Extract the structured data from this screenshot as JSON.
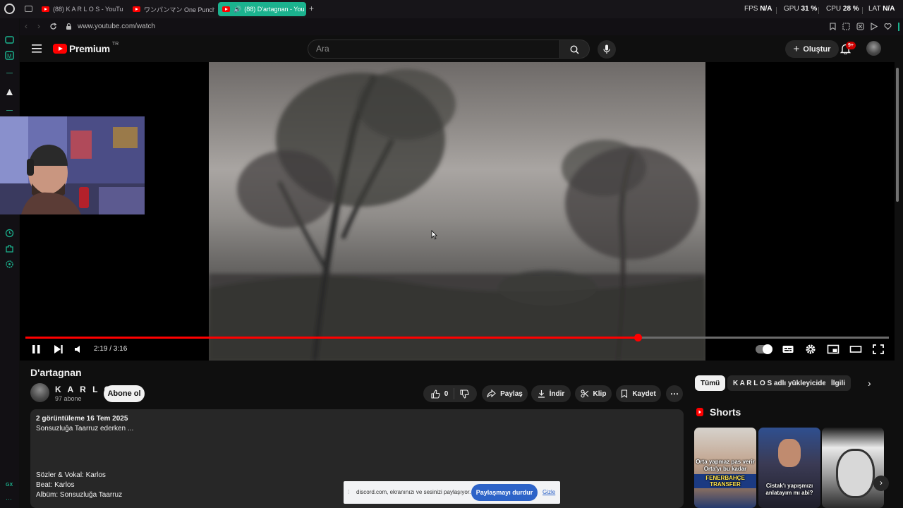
{
  "browser": {
    "tabs": [
      {
        "label": "(88) K A R L O S - YouTube",
        "active": false
      },
      {
        "label": "ワンパンマン One Punch Man",
        "active": false
      },
      {
        "label": "(88) D'artagnan - You",
        "active": true
      }
    ],
    "new_tab_label": "+",
    "stats": {
      "fps_label": "FPS",
      "fps_value": "N/A",
      "gpu_label": "GPU",
      "gpu_value": "31 %",
      "cpu_label": "CPU",
      "cpu_value": "28 %",
      "lat_label": "LAT",
      "lat_value": "N/A"
    },
    "url": "www.youtube.com/watch",
    "sidebar_footer": "GX"
  },
  "youtube": {
    "logo_text": "Premium",
    "logo_region": "TR",
    "search_placeholder": "Ara",
    "create_label": "Oluştur",
    "notifications_badge": "9+"
  },
  "player": {
    "time_display": "2:19 / 3:16",
    "progress_fraction": 0.709
  },
  "video": {
    "title": "D'artagnan",
    "channel_name": "K A R L O S",
    "subscribers": "97 abone",
    "subscribe_label": "Abone ol",
    "like_count": "0",
    "share_label": "Paylaş",
    "download_label": "İndir",
    "clip_label": "Klip",
    "save_label": "Kaydet",
    "more_label": "⋯",
    "views_date": "2 görüntüleme  16 Tem 2025",
    "description_lines": [
      "Sonsuzluğa Taarruz ederken ...",
      "Sözler & Vokal: Karlos",
      "Beat: Karlos",
      "Albüm: Sonsuzluğa Taarruz"
    ]
  },
  "sidebar_right": {
    "chips": [
      "Tümü",
      "K A R L O S adlı yükleyiciden",
      "İlgili"
    ],
    "shorts_title": "Shorts",
    "shorts": [
      {
        "caption_top": "Orta yapmaz pas verir",
        "caption_mid": "Orta'yı bu kadar",
        "caption_bottom": "FENERBAHÇE TRANSFER"
      },
      {
        "caption_top": "Cistak'ı yapışmızı",
        "caption_bottom": "anlatayım mı abi?"
      },
      {
        "caption_top": ""
      }
    ]
  },
  "discord_share": {
    "message": "discord.com, ekranınızı ve sesinizi paylaşıyor.",
    "stop_label": "Paylaşmayı durdur",
    "hide_label": "Gizle"
  },
  "colors": {
    "accent_gx": "#1bb28e",
    "youtube_red": "#ff0000",
    "background": "#0f0f0f",
    "discord_blue": "#2d63c8"
  }
}
